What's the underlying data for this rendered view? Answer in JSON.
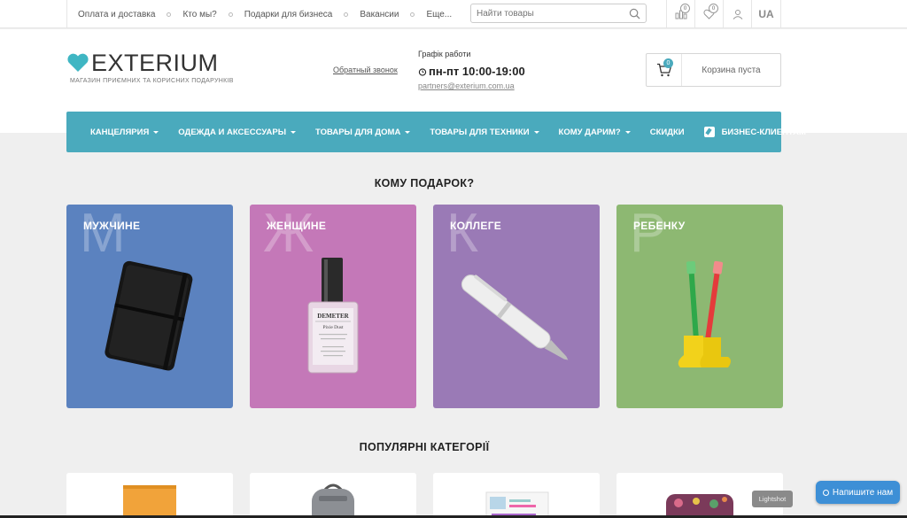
{
  "topbar": {
    "links": [
      "Оплата и доставка",
      "Кто мы?",
      "Подарки для бизнеса",
      "Вакансии",
      "Еще..."
    ],
    "search_placeholder": "Найти товары",
    "compare_count": "0",
    "wishlist_count": "0",
    "lang": "UA"
  },
  "header": {
    "brand": "EXTERIUM",
    "tagline": "МАГАЗИН ПРИЄМНИХ ТА КОРИСНИХ ПОДАРУНКІВ",
    "callback": "Обратный звонок",
    "schedule_title": "Графік работи",
    "schedule_hours": "пн-пт 10:00-19:00",
    "email": "partners@exterium.com.ua",
    "cart_count": "0",
    "cart_text": "Корзина пуста"
  },
  "nav": {
    "items": [
      {
        "label": "КАНЦЕЛЯРИЯ"
      },
      {
        "label": "ОДЕЖДА И АКСЕССУАРЫ"
      },
      {
        "label": "ТОВАРЫ ДЛЯ ДОМА"
      },
      {
        "label": "ТОВАРЫ ДЛЯ ТЕХНИКИ"
      },
      {
        "label": "КОМУ ДАРИМ?"
      },
      {
        "label": "СКИДКИ"
      }
    ],
    "business": "БИЗНЕС-КЛИЕНТАМ"
  },
  "gifts": {
    "title": "КОМУ ПОДАРОК?",
    "cards": [
      {
        "label": "МУЖЧИНЕ",
        "letter": "М",
        "color": "#5b82bf"
      },
      {
        "label": "ЖЕНЩИНЕ",
        "letter": "Ж",
        "color": "#c478b8"
      },
      {
        "label": "КОЛЛЕГЕ",
        "letter": "К",
        "color": "#9a7ab6"
      },
      {
        "label": "РЕБЕНКУ",
        "letter": "Р",
        "color": "#8db872"
      }
    ]
  },
  "popular": {
    "title": "ПОПУЛЯРНІ КАТЕГОРІЇ"
  },
  "perfume": {
    "brand": "DEMETER",
    "name": "Pixie Dust"
  },
  "widgets": {
    "lightshot": "Lightshot",
    "chat": "Напишите нам"
  },
  "colors": {
    "accent": "#4aaabd",
    "chat": "#3d8fd6"
  }
}
